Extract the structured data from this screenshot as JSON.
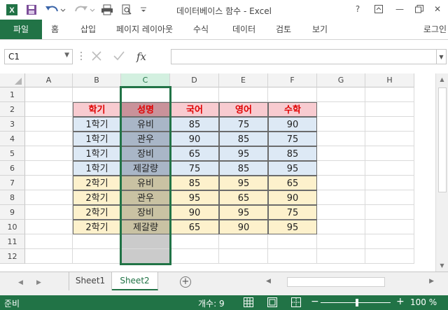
{
  "window": {
    "title": "데이터베이스 함수 - Excel",
    "help": "?",
    "minimize": "—",
    "close": "✕"
  },
  "ribbon": {
    "file_tab": "파일",
    "tabs": [
      "홈",
      "삽입",
      "페이지 레이아웃",
      "수식",
      "데이터",
      "검토",
      "보기"
    ],
    "login": "로그인"
  },
  "formula_bar": {
    "name_box": "C1",
    "fx_label": "fx",
    "formula": ""
  },
  "grid": {
    "columns": [
      "A",
      "B",
      "C",
      "D",
      "E",
      "F",
      "G",
      "H"
    ],
    "selected_column": "C",
    "rows": [
      "1",
      "2",
      "3",
      "4",
      "5",
      "6",
      "7",
      "8",
      "9",
      "10",
      "11",
      "12"
    ],
    "table": {
      "headers": [
        "학기",
        "성명",
        "국어",
        "영어",
        "수학"
      ],
      "rows": [
        [
          "1학기",
          "유비",
          "85",
          "75",
          "90"
        ],
        [
          "1학기",
          "관우",
          "90",
          "85",
          "75"
        ],
        [
          "1학기",
          "장비",
          "65",
          "95",
          "85"
        ],
        [
          "1학기",
          "제갈량",
          "75",
          "85",
          "95"
        ],
        [
          "2학기",
          "유비",
          "85",
          "95",
          "65"
        ],
        [
          "2학기",
          "관우",
          "95",
          "65",
          "90"
        ],
        [
          "2학기",
          "장비",
          "90",
          "95",
          "75"
        ],
        [
          "2학기",
          "제갈량",
          "65",
          "90",
          "95"
        ]
      ]
    },
    "colors": {
      "header_fill": "#f8cbd0",
      "name_header_fill": "#c9929a",
      "header_text": "#e00000",
      "sem1_fill": "#dde9f5",
      "sem1_name_fill": "#a9b6c7",
      "sem2_fill": "#fdf1cc",
      "sem2_name_fill": "#c9c2a3",
      "empty_selected_fill": "#cbcbcb",
      "selection_border": "#217346"
    }
  },
  "sheets": {
    "tabs": [
      "Sheet1",
      "Sheet2"
    ],
    "active": "Sheet2",
    "add_icon": "+"
  },
  "status": {
    "ready": "준비",
    "count": "개수: 9",
    "zoom": "100 %"
  }
}
